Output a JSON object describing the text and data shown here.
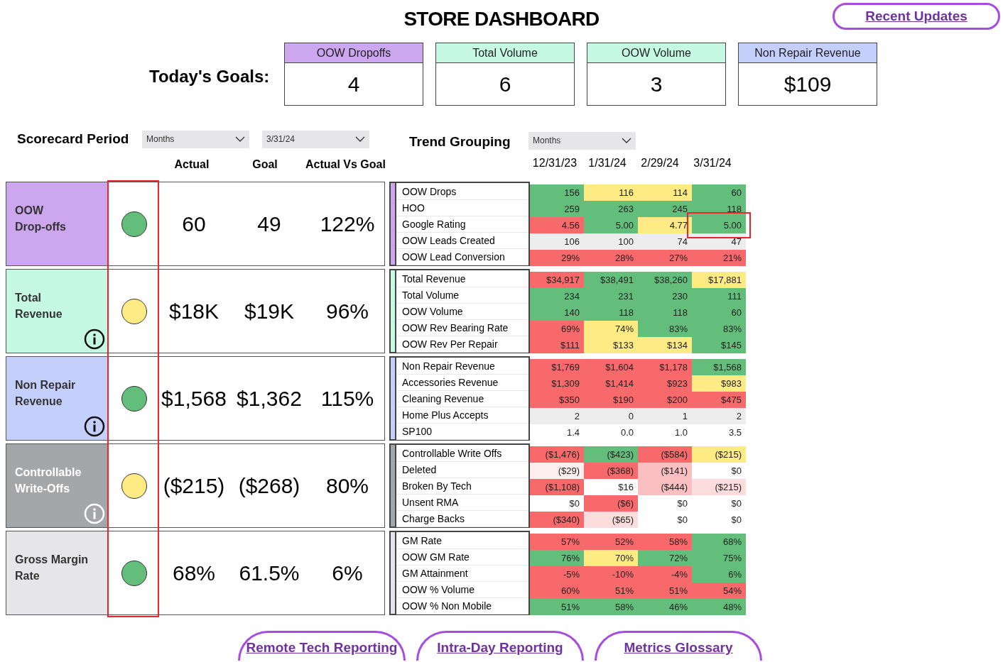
{
  "title": "STORE DASHBOARD",
  "recent_updates_link": "Recent Updates",
  "goals": {
    "label": "Today's Goals:",
    "items": [
      {
        "title": "OOW Dropoffs",
        "value": "4",
        "color": "#cca6ee"
      },
      {
        "title": "Total Volume",
        "value": "6",
        "color": "#c5f9e3"
      },
      {
        "title": "OOW Volume",
        "value": "3",
        "color": "#c5f9e3"
      },
      {
        "title": "Non Repair Revenue",
        "value": "$109",
        "color": "#c4cffb"
      }
    ]
  },
  "scorecard_period": {
    "label": "Scorecard Period",
    "dropdowns": [
      "Months",
      "3/31/24"
    ]
  },
  "trend_grouping": {
    "label": "Trend Grouping",
    "dropdown": "Months"
  },
  "scorecard_columns": [
    "Actual",
    "Goal",
    "Actual Vs Goal"
  ],
  "trend_columns": [
    "12/31/23",
    "1/31/24",
    "2/29/24",
    "3/31/24"
  ],
  "scorecards": [
    {
      "name": "OOW\nDrop-offs",
      "color": "#cca6ee",
      "kind": "dark-label",
      "status": {
        "color": "#63be7b"
      },
      "actual": "60",
      "goal": "49",
      "vs_goal": "122%",
      "metrics": [
        {
          "name": "OOW Drops",
          "cells": [
            {
              "value": "156",
              "color": "#63be7b"
            },
            {
              "value": "116",
              "color": "#ffeb84"
            },
            {
              "value": "114",
              "color": "#ffeb84"
            },
            {
              "value": "60",
              "color": "#63be7b"
            }
          ]
        },
        {
          "name": "HOO",
          "cells": [
            {
              "value": "259",
              "color": "#63be7b"
            },
            {
              "value": "263",
              "color": "#63be7b"
            },
            {
              "value": "245",
              "color": "#63be7b"
            },
            {
              "value": "118",
              "color": "#63be7b"
            }
          ]
        },
        {
          "name": "Google Rating",
          "cells": [
            {
              "value": "4.56",
              "color": "#f8696b"
            },
            {
              "value": "5.00",
              "color": "#63be7b"
            },
            {
              "value": "4.77",
              "color": "#ffeb84"
            },
            {
              "value": "5.00",
              "color": "#63be7b",
              "highlighted": true
            }
          ]
        },
        {
          "name": "OOW Leads Created",
          "cells": [
            {
              "value": "106",
              "color": "#ededed"
            },
            {
              "value": "100",
              "color": "#ededed"
            },
            {
              "value": "74",
              "color": "#ededed"
            },
            {
              "value": "47",
              "color": "#ededed"
            }
          ]
        },
        {
          "name": "OOW Lead Conversion",
          "cells": [
            {
              "value": "29%",
              "color": "#f8696b"
            },
            {
              "value": "28%",
              "color": "#f8696b"
            },
            {
              "value": "27%",
              "color": "#f8696b"
            },
            {
              "value": "21%",
              "color": "#f8696b"
            }
          ]
        }
      ]
    },
    {
      "name": "Total\nRevenue",
      "color": "#c5f9e3",
      "kind": "dark-label",
      "info_icon": {
        "kind": "dark"
      },
      "status": {
        "color": "#ffeb84"
      },
      "actual": "$18K",
      "goal": "$19K",
      "vs_goal": "96%",
      "metrics": [
        {
          "name": "Total Revenue",
          "cells": [
            {
              "value": "$34,917",
              "color": "#f8696b"
            },
            {
              "value": "$38,491",
              "color": "#63be7b"
            },
            {
              "value": "$38,260",
              "color": "#63be7b"
            },
            {
              "value": "$17,881",
              "color": "#ffeb84"
            }
          ]
        },
        {
          "name": "Total Volume",
          "cells": [
            {
              "value": "234",
              "color": "#63be7b"
            },
            {
              "value": "231",
              "color": "#63be7b"
            },
            {
              "value": "230",
              "color": "#63be7b"
            },
            {
              "value": "111",
              "color": "#63be7b"
            }
          ]
        },
        {
          "name": "OOW Volume",
          "cells": [
            {
              "value": "140",
              "color": "#63be7b"
            },
            {
              "value": "118",
              "color": "#63be7b"
            },
            {
              "value": "118",
              "color": "#63be7b"
            },
            {
              "value": "60",
              "color": "#63be7b"
            }
          ]
        },
        {
          "name": "OOW Rev Bearing Rate",
          "cells": [
            {
              "value": "69%",
              "color": "#f8696b"
            },
            {
              "value": "74%",
              "color": "#ffeb84"
            },
            {
              "value": "83%",
              "color": "#63be7b"
            },
            {
              "value": "83%",
              "color": "#63be7b"
            }
          ]
        },
        {
          "name": "OOW Rev Per Repair",
          "cells": [
            {
              "value": "$111",
              "color": "#f8696b"
            },
            {
              "value": "$133",
              "color": "#ffeb84"
            },
            {
              "value": "$134",
              "color": "#ffeb84"
            },
            {
              "value": "$145",
              "color": "#63be7b"
            }
          ]
        }
      ]
    },
    {
      "name": "Non Repair\nRevenue",
      "color": "#c4cffb",
      "kind": "dark-label",
      "info_icon": {
        "kind": "dark"
      },
      "status": {
        "color": "#63be7b"
      },
      "actual": "$1,568",
      "goal": "$1,362",
      "vs_goal": "115%",
      "metrics": [
        {
          "name": "Non Repair Revenue",
          "cells": [
            {
              "value": "$1,769",
              "color": "#f8696b"
            },
            {
              "value": "$1,604",
              "color": "#f8696b"
            },
            {
              "value": "$1,178",
              "color": "#f8696b"
            },
            {
              "value": "$1,568",
              "color": "#63be7b"
            }
          ]
        },
        {
          "name": "Accessories Revenue",
          "cells": [
            {
              "value": "$1,309",
              "color": "#f8696b"
            },
            {
              "value": "$1,414",
              "color": "#f8696b"
            },
            {
              "value": "$923",
              "color": "#f8696b"
            },
            {
              "value": "$983",
              "color": "#ffeb84"
            }
          ]
        },
        {
          "name": "Cleaning Revenue",
          "cells": [
            {
              "value": "$350",
              "color": "#f8696b"
            },
            {
              "value": "$190",
              "color": "#f8696b"
            },
            {
              "value": "$200",
              "color": "#f8696b"
            },
            {
              "value": "$475",
              "color": "#f8696b"
            }
          ]
        },
        {
          "name": "Home Plus Accepts",
          "cells": [
            {
              "value": "2",
              "color": "#ededed"
            },
            {
              "value": "0",
              "color": "#ededed"
            },
            {
              "value": "1",
              "color": "#ededed"
            },
            {
              "value": "2",
              "color": "#ededed"
            }
          ]
        },
        {
          "name": "SP100",
          "cells": [
            {
              "value": "1.4",
              "color": "#ffffff"
            },
            {
              "value": "0.0",
              "color": "#ffffff"
            },
            {
              "value": "1.0",
              "color": "#ffffff"
            },
            {
              "value": "3.5",
              "color": "#ffffff"
            }
          ]
        }
      ]
    },
    {
      "name": "Controllable\nWrite-Offs",
      "color": "#a4a7aa",
      "kind": "light-label",
      "info_icon": {
        "kind": "light"
      },
      "status": {
        "color": "#ffeb84"
      },
      "actual": "($215)",
      "goal": "($268)",
      "vs_goal": "80%",
      "metrics": [
        {
          "name": "Controllable Write Offs",
          "cells": [
            {
              "value": "($1,476)",
              "color": "#f8696b"
            },
            {
              "value": "($423)",
              "color": "#63be7b"
            },
            {
              "value": "($584)",
              "color": "#f8696b"
            },
            {
              "value": "($215)",
              "color": "#ffeb84"
            }
          ]
        },
        {
          "name": "Deleted",
          "cells": [
            {
              "value": "($29)",
              "color": "#fdeff0"
            },
            {
              "value": "($368)",
              "color": "#f8696b"
            },
            {
              "value": "($141)",
              "color": "#fabfc0"
            },
            {
              "value": "$0",
              "color": "#ffffff"
            }
          ]
        },
        {
          "name": "Broken By Tech",
          "cells": [
            {
              "value": "($1,108)",
              "color": "#f8696b"
            },
            {
              "value": "$16",
              "color": "#ffffff"
            },
            {
              "value": "($444)",
              "color": "#fabfc0"
            },
            {
              "value": "($215)",
              "color": "#fcdcdd"
            }
          ]
        },
        {
          "name": "Unsent RMA",
          "cells": [
            {
              "value": "$0",
              "color": "#ffffff"
            },
            {
              "value": "($6)",
              "color": "#f8696b"
            },
            {
              "value": "$0",
              "color": "#ffffff"
            },
            {
              "value": "$0",
              "color": "#ffffff"
            }
          ]
        },
        {
          "name": "Charge Backs",
          "cells": [
            {
              "value": "($340)",
              "color": "#f8696b"
            },
            {
              "value": "($65)",
              "color": "#fcdcdd"
            },
            {
              "value": "$0",
              "color": "#ffffff"
            },
            {
              "value": "$0",
              "color": "#ffffff"
            }
          ]
        }
      ]
    },
    {
      "name": "Gross Margin\nRate",
      "color": "#e6e5ea",
      "kind": "dark-label",
      "status": {
        "color": "#63be7b"
      },
      "actual": "68%",
      "goal": "61.5%",
      "vs_goal": "6%",
      "metrics": [
        {
          "name": "GM Rate",
          "cells": [
            {
              "value": "57%",
              "color": "#f8696b"
            },
            {
              "value": "52%",
              "color": "#f8696b"
            },
            {
              "value": "58%",
              "color": "#f8696b"
            },
            {
              "value": "68%",
              "color": "#63be7b"
            }
          ]
        },
        {
          "name": "OOW GM Rate",
          "cells": [
            {
              "value": "76%",
              "color": "#63be7b"
            },
            {
              "value": "70%",
              "color": "#ffeb84"
            },
            {
              "value": "72%",
              "color": "#63be7b"
            },
            {
              "value": "75%",
              "color": "#63be7b"
            }
          ]
        },
        {
          "name": "GM Attainment",
          "cells": [
            {
              "value": "-5%",
              "color": "#f8696b"
            },
            {
              "value": "-10%",
              "color": "#f8696b"
            },
            {
              "value": "-4%",
              "color": "#f8696b"
            },
            {
              "value": "6%",
              "color": "#63be7b"
            }
          ]
        },
        {
          "name": "OOW % Volume",
          "cells": [
            {
              "value": "60%",
              "color": "#f8696b"
            },
            {
              "value": "51%",
              "color": "#f8696b"
            },
            {
              "value": "51%",
              "color": "#f8696b"
            },
            {
              "value": "54%",
              "color": "#f8696b"
            }
          ]
        },
        {
          "name": "OOW % Non Mobile",
          "cells": [
            {
              "value": "51%",
              "color": "#63be7b"
            },
            {
              "value": "58%",
              "color": "#63be7b"
            },
            {
              "value": "46%",
              "color": "#63be7b"
            },
            {
              "value": "48%",
              "color": "#63be7b"
            }
          ]
        }
      ]
    }
  ],
  "status_column_highlighted": true,
  "footer_links": [
    "Remote Tech Reporting",
    "Intra-Day Reporting",
    "Metrics Glossary"
  ]
}
